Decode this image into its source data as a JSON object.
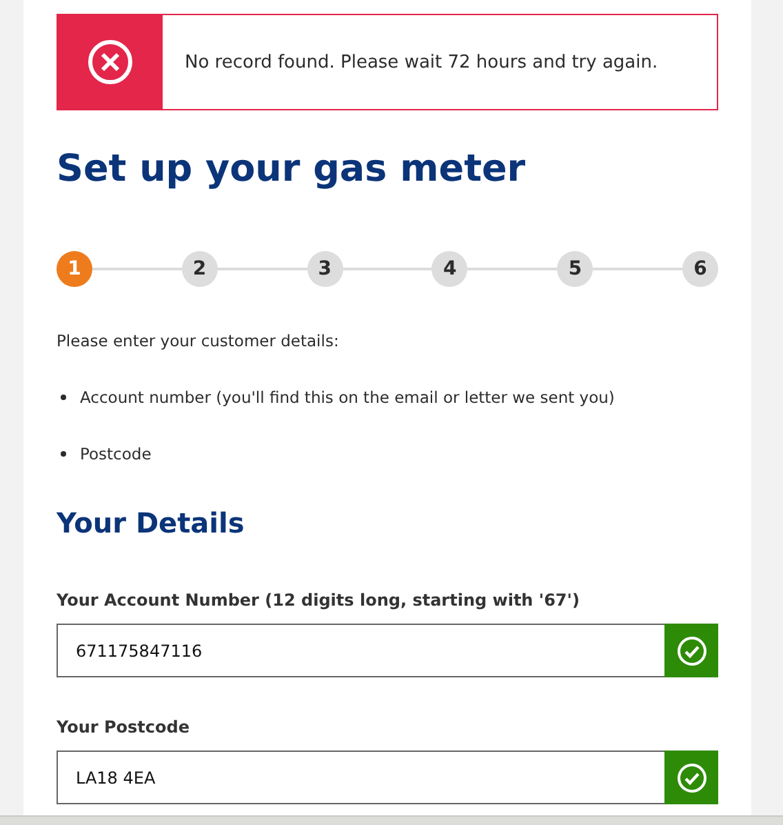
{
  "alert": {
    "kind": "error",
    "message": "No record found. Please wait 72 hours and try again."
  },
  "title": "Set up your gas meter",
  "steps": [
    {
      "label": "1",
      "selected": true
    },
    {
      "label": "2",
      "selected": false
    },
    {
      "label": "3",
      "selected": false
    },
    {
      "label": "4",
      "selected": false
    },
    {
      "label": "5",
      "selected": false
    },
    {
      "label": "6",
      "selected": false
    }
  ],
  "intro": "Please enter your customer details:",
  "requirements": [
    "Account number (you'll find this on the email or letter we sent you)",
    "Postcode"
  ],
  "section_title": "Your Details",
  "fields": [
    {
      "label": "Your Account Number (12 digits long, starting with '67')",
      "value": "671175847116",
      "valid": true
    },
    {
      "label": "Your Postcode",
      "value": "LA18 4EA",
      "valid": true
    }
  ]
}
